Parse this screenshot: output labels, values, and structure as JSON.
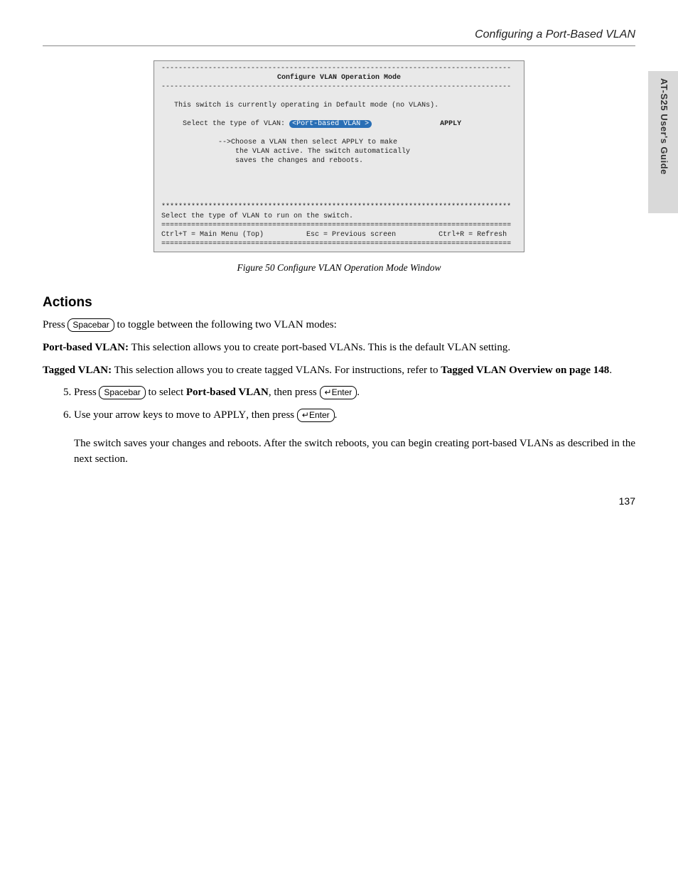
{
  "header": {
    "right": "Configuring a Port-Based VLAN"
  },
  "sidetab": "AT-S25 User's Guide",
  "terminal": {
    "title": "Configure VLAN Operation Mode",
    "line1": "This switch is currently operating in Default mode (no VLANs).",
    "select_prefix": "Select the type of VLAN:",
    "select_value": "<Port-based VLAN >",
    "apply": "APPLY",
    "hint1": "-->Choose a VLAN then select APPLY to make",
    "hint2": "    the VLAN active. The switch automatically",
    "hint3": "    saves the changes and reboots.",
    "footer1": "Select the type of VLAN to run on the switch.",
    "ctrl_t": "Ctrl+T = Main Menu (Top)",
    "esc": "Esc = Previous screen",
    "ctrl_r": "Ctrl+R = Refresh"
  },
  "figure_caption": "Figure 50  Configure VLAN Operation Mode Window",
  "section_title": "Actions",
  "para1_pre": "Press ",
  "para1_post": " to toggle between the following two VLAN modes:",
  "keycap_spacebar": "Spacebar",
  "bullet1_label": "Port-based VLAN:",
  "bullet1_text": " This selection allows you to create port-based VLANs. This is the default VLAN setting.",
  "bullet2_label": "Tagged VLAN:",
  "bullet2_text": " This selection allows you to create tagged VLANs. For instructions, refer to ",
  "bullet2_link": "Tagged VLAN Overview on page 148",
  "bullet2_end": ".",
  "steps": {
    "s5_a": "Press ",
    "s5_b": " to select ",
    "s5_port": "Port-based VLAN",
    "s5_c": ", then press ",
    "s5_d": ".",
    "s6_a": "Use your arrow keys to move to ",
    "s6_b": "APPLY",
    "s6_c": ", then press ",
    "s6_d": "."
  },
  "keycap_enter": "Enter",
  "final_para": "The switch saves your changes and reboots. After the switch reboots, you can begin creating port-based VLANs as described in the next section.",
  "pagenum": "137"
}
